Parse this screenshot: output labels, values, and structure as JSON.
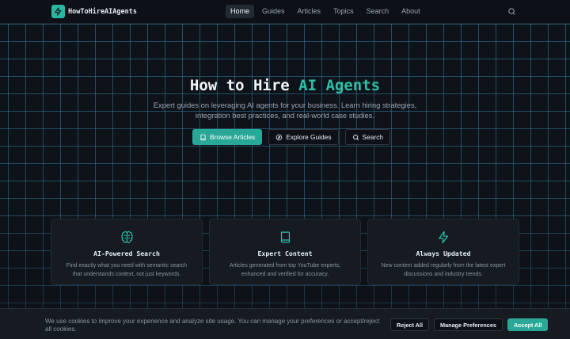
{
  "header": {
    "brand": "HowToHireAIAgents",
    "nav": [
      {
        "label": "Home",
        "active": true
      },
      {
        "label": "Guides",
        "active": false
      },
      {
        "label": "Articles",
        "active": false
      },
      {
        "label": "Topics",
        "active": false
      },
      {
        "label": "Search",
        "active": false
      },
      {
        "label": "About",
        "active": false
      }
    ],
    "search_icon": "search-icon",
    "logo_icon": "zap-icon"
  },
  "hero": {
    "title_prefix": "How to Hire ",
    "title_accent": "AI Agents",
    "subtitle": "Expert guides on leveraging AI agents for your business. Learn hiring strategies, integration best practices, and real-world case studies.",
    "buttons": {
      "browse": "Browse Articles",
      "explore": "Explore Guides",
      "search": "Search"
    }
  },
  "features": [
    {
      "icon": "brain-icon",
      "title": "AI-Powered Search",
      "text": "Find exactly what you need with semantic search that understands context, not just keywords."
    },
    {
      "icon": "book-icon",
      "title": "Expert Content",
      "text": "Articles generated from top YouTube experts, enhanced and verified for accuracy."
    },
    {
      "icon": "zap-icon",
      "title": "Always Updated",
      "text": "New content added regularly from the latest expert discussions and industry trends."
    }
  ],
  "cookie": {
    "text": "We use cookies to improve your experience and analyze site usage. You can manage your preferences or accept/reject all cookies.",
    "reject": "Reject All",
    "manage": "Manage Preferences",
    "accept": "Accept All"
  },
  "colors": {
    "accent": "#2bc1a8",
    "background": "#0d1117",
    "card": "#161b22"
  }
}
